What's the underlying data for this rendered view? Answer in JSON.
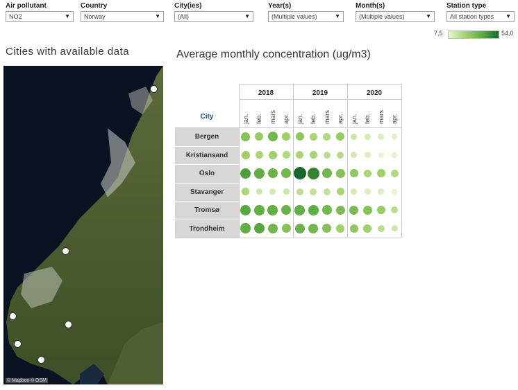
{
  "filters": [
    {
      "label": "Air pollutant",
      "value": "NO2"
    },
    {
      "label": "Country",
      "value": "Norway"
    },
    {
      "label": "City(ies)",
      "value": "(All)"
    },
    {
      "label": "Year(s)",
      "value": "(Multiple values)"
    },
    {
      "label": "Month(s)",
      "value": "(Multiple values)"
    },
    {
      "label": "Station type",
      "value": "All station types"
    }
  ],
  "legend": {
    "min": "7,5",
    "max": "54,0"
  },
  "map": {
    "title": "Cities with available data",
    "attribution": "© Mapbox © OSM"
  },
  "chart": {
    "title": "Average monthly concentration (ug/m3)",
    "city_header": "City",
    "years": [
      "2018",
      "2019",
      "2020"
    ],
    "months": [
      "jan.",
      "feb.",
      "mars",
      "apr."
    ],
    "cities": [
      "Bergen",
      "Kristiansand",
      "Oslo",
      "Stavanger",
      "Tromsø",
      "Trondheim"
    ]
  },
  "chart_data": {
    "type": "heatmap",
    "title": "Average monthly concentration (ug/m3)",
    "scale": {
      "min": 7.5,
      "max": 54.0
    },
    "columns": [
      "2018 jan.",
      "2018 feb.",
      "2018 mars",
      "2018 apr.",
      "2019 jan.",
      "2019 feb.",
      "2019 mars",
      "2019 apr.",
      "2020 jan.",
      "2020 feb.",
      "2020 mars",
      "2020 apr."
    ],
    "rows": [
      "Bergen",
      "Kristiansand",
      "Oslo",
      "Stavanger",
      "Tromsø",
      "Trondheim"
    ],
    "values": [
      [
        30,
        26,
        34,
        24,
        28,
        22,
        20,
        26,
        14,
        12,
        10,
        9
      ],
      [
        24,
        22,
        24,
        20,
        22,
        22,
        18,
        19,
        12,
        10,
        8,
        8
      ],
      [
        42,
        38,
        36,
        34,
        54,
        48,
        34,
        30,
        28,
        22,
        24,
        20
      ],
      [
        22,
        14,
        12,
        14,
        18,
        16,
        16,
        22,
        12,
        10,
        10,
        8
      ],
      [
        40,
        38,
        38,
        36,
        38,
        38,
        34,
        32,
        32,
        30,
        26,
        18
      ],
      [
        38,
        40,
        34,
        30,
        36,
        34,
        30,
        24,
        28,
        24,
        18,
        14
      ]
    ]
  },
  "map_points": [
    {
      "name": "point-north",
      "mx": 216,
      "my": 33
    },
    {
      "name": "point-trondheim",
      "mx": 89,
      "my": 267
    },
    {
      "name": "point-bergen",
      "mx": 13,
      "my": 361
    },
    {
      "name": "point-oslo",
      "mx": 93,
      "my": 373
    },
    {
      "name": "point-stavanger",
      "mx": 20,
      "my": 401
    },
    {
      "name": "point-kristiansand",
      "mx": 54,
      "my": 424
    }
  ],
  "colors": {
    "grid": "#c8c8c8",
    "row_label_bg": "#d7d7d7",
    "city_header": "#1f4a8a"
  }
}
